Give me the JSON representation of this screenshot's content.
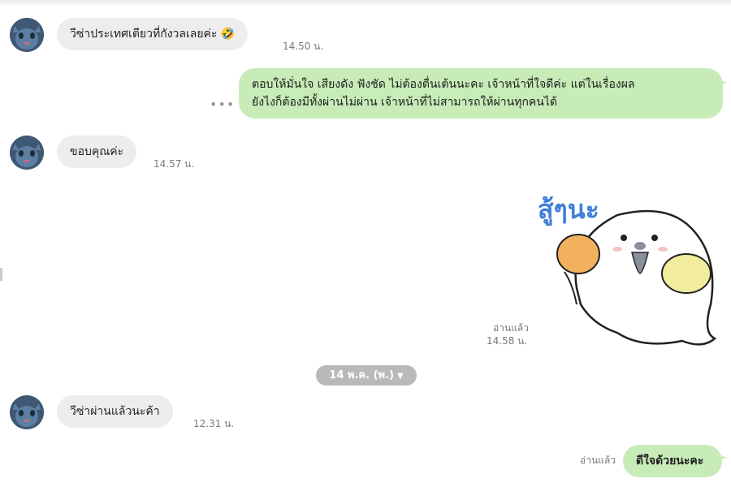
{
  "messages": [
    {
      "from": "them",
      "text": "วีซ่าประเทศเตียวที่กังวลเลยค่ะ",
      "emoji": "🤣",
      "time": "14.50 น."
    },
    {
      "from": "me",
      "line1": "ตอบให้มั่นใจ เสียงดัง ฟังชัด ไม่ต้องตื่นเต้นนะคะ เจ้าหน้าที่ใจดีค่ะ แต่ในเรื่องผล",
      "line2": "ยังไงก็ต้องมีทั้งผ่านไม่ผ่าน เจ้าหน้าที่ไม่สามารถให้ผ่านทุกคนได้"
    },
    {
      "from": "them",
      "text": "ขอบคุณค่ะ",
      "time": "14.57 น."
    },
    {
      "from": "me",
      "sticker_text": "สู้ๆนะ",
      "read": "อ่านแล้ว",
      "time": "14.58 น."
    },
    {
      "from": "them",
      "text": "วีซ่าผ่านแล้วนะค้า",
      "time": "12.31 น."
    },
    {
      "from": "me",
      "text": "ดีใจด้วยนะคะ",
      "read": "อ่านแล้ว"
    }
  ],
  "date_divider": {
    "label": "14 พ.ค. (พ.)",
    "icon": "chevron-down"
  },
  "more_icon": "•••",
  "colors": {
    "bubble_in": "#ededf0",
    "bubble_out": "#c7ecb8",
    "date_pill": "#b9b9b9"
  }
}
